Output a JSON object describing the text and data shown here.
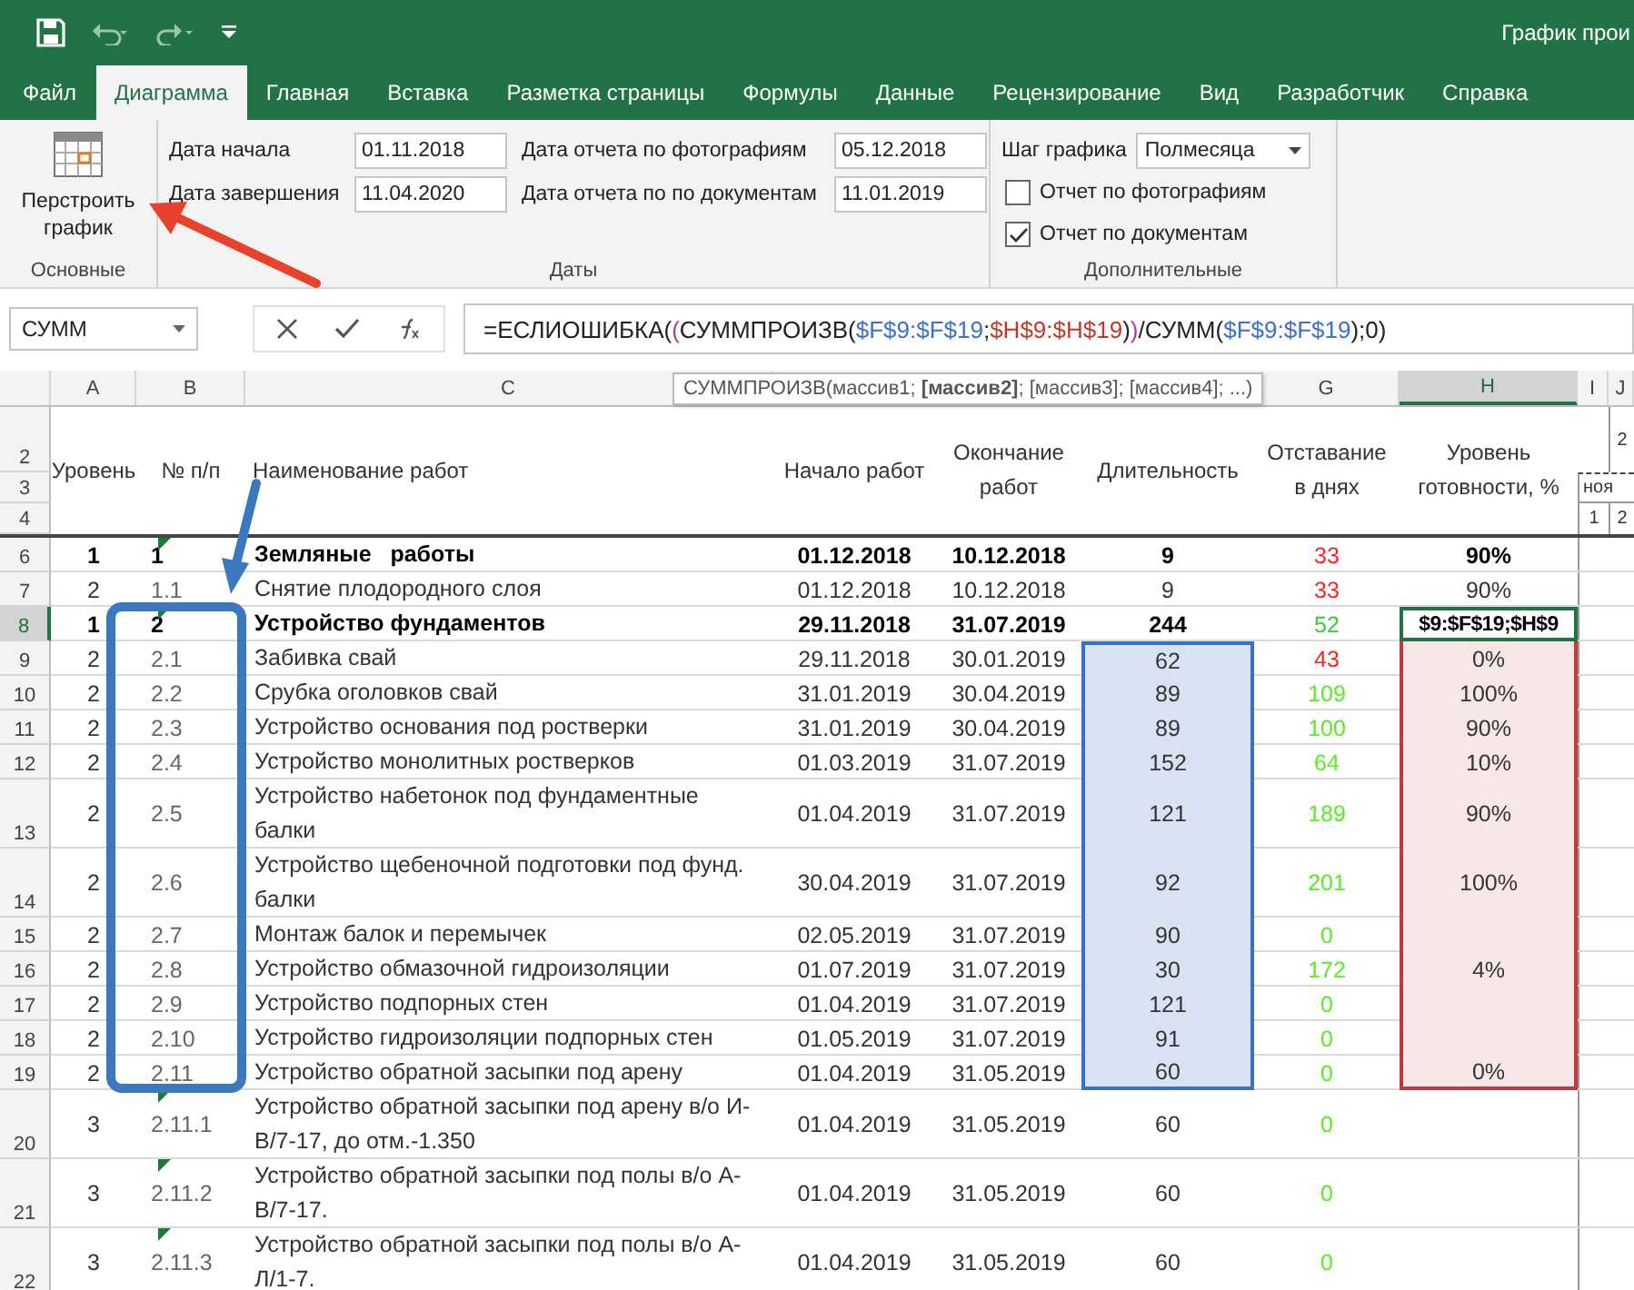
{
  "title_bar": {
    "title": "График прои"
  },
  "ribbon_tabs": [
    {
      "label": "Файл",
      "selected": false
    },
    {
      "label": "Диаграмма",
      "selected": true
    },
    {
      "label": "Главная",
      "selected": false
    },
    {
      "label": "Вставка",
      "selected": false
    },
    {
      "label": "Разметка страницы",
      "selected": false
    },
    {
      "label": "Формулы",
      "selected": false
    },
    {
      "label": "Данные",
      "selected": false
    },
    {
      "label": "Рецензирование",
      "selected": false
    },
    {
      "label": "Вид",
      "selected": false
    },
    {
      "label": "Разработчик",
      "selected": false
    },
    {
      "label": "Справка",
      "selected": false
    }
  ],
  "ribbon": {
    "main_group": {
      "label": "Основные",
      "button": "Перстроить график"
    },
    "dates_group": {
      "label": "Даты",
      "fields": [
        {
          "label": "Дата начала",
          "value": "01.11.2018"
        },
        {
          "label": "Дата отчета по фотографиям",
          "value": "05.12.2018"
        },
        {
          "label": "Дата завершения",
          "value": "11.04.2020"
        },
        {
          "label": "Дата отчета по по документам",
          "value": "11.01.2019"
        }
      ]
    },
    "extra_group": {
      "label": "Дополнительные",
      "step_label": "Шаг графика",
      "step_value": "Полмесяца",
      "checkboxes": [
        {
          "label": "Отчет по фотографиям",
          "checked": false
        },
        {
          "label": "Отчет по документам",
          "checked": true
        }
      ]
    }
  },
  "formula_bar": {
    "name_box": "СУММ",
    "segments": [
      {
        "text": "=ЕСЛИОШИБКА(",
        "color": "#222222"
      },
      {
        "text": "(",
        "color": "#b03aa0"
      },
      {
        "text": "СУММПРОИЗВ(",
        "color": "#222222"
      },
      {
        "text": "$F$9:$F$19",
        "color": "#3b6fd0"
      },
      {
        "text": ";",
        "color": "#222222"
      },
      {
        "text": "$H$9:$H$19",
        "color": "#c0392b"
      },
      {
        "text": ")",
        "color": "#222222"
      },
      {
        "text": ")",
        "color": "#b03aa0"
      },
      {
        "text": "/СУММ(",
        "color": "#222222"
      },
      {
        "text": "$F$9:$F$19",
        "color": "#3b6fd0"
      },
      {
        "text": ");0)",
        "color": "#222222"
      }
    ]
  },
  "tooltip": "СУММПРОИЗВ(массив1; **[массив2]**; [массив3]; [массив4]; ...)",
  "columns": [
    {
      "label": "A",
      "selected": false
    },
    {
      "label": "B",
      "selected": false
    },
    {
      "label": "C",
      "selected": false
    },
    {
      "label": "G",
      "selected": false
    },
    {
      "label": "H",
      "selected": true
    },
    {
      "label": "I",
      "selected": false
    },
    {
      "label": "J",
      "selected": false
    }
  ],
  "header_row_numbers": [
    "2",
    "3",
    "4"
  ],
  "headers": [
    "Уровень",
    "№ п/п",
    "Наименование работ",
    "Начало работ",
    "Окончание работ",
    "Длительность",
    "Отставание в днях",
    "Уровень готовности, %"
  ],
  "side_header": {
    "year": "2",
    "month": "ноя",
    "days": [
      "1",
      "2"
    ]
  },
  "rows": [
    {
      "num": "6",
      "level": "1",
      "code": "1",
      "name": "Земляные   работы",
      "start": "01.12.2018",
      "end": "10.12.2018",
      "duration": "9",
      "lag": "33",
      "color": "#ff2020",
      "ready": "90%",
      "bold": true,
      "tall": false,
      "active": false,
      "marker": true,
      "editing": false,
      "duration_selected": false,
      "ready_selected": false
    },
    {
      "num": "7",
      "level": "2",
      "code": "1.1",
      "name": "Снятие плодородного слоя",
      "start": "01.12.2018",
      "end": "10.12.2018",
      "duration": "9",
      "lag": "33",
      "color": "#ff2020",
      "ready": "90%",
      "bold": false,
      "tall": false,
      "active": false,
      "marker": false,
      "editing": false,
      "duration_selected": false,
      "ready_selected": false
    },
    {
      "num": "8",
      "level": "1",
      "code": "2",
      "name": "Устройство фундаментов",
      "start": "29.11.2018",
      "end": "31.07.2019",
      "duration": "244",
      "lag": "52",
      "color": "#33cc33",
      "ready": "$9:$F$19;$H$9",
      "bold": true,
      "tall": false,
      "active": true,
      "marker": true,
      "editing": true,
      "duration_selected": false,
      "ready_selected": false
    },
    {
      "num": "9",
      "level": "2",
      "code": "2.1",
      "name": "Забивка свай",
      "start": "29.11.2018",
      "end": "30.01.2019",
      "duration": "62",
      "lag": "43",
      "color": "#ff2020",
      "ready": "0%",
      "bold": false,
      "tall": false,
      "active": false,
      "marker": false,
      "editing": false,
      "duration_selected": true,
      "ready_selected": true
    },
    {
      "num": "10",
      "level": "2",
      "code": "2.2",
      "name": "Срубка оголовков свай",
      "start": "31.01.2019",
      "end": "30.04.2019",
      "duration": "89",
      "lag": "109",
      "color": "#55ee22",
      "ready": "100%",
      "bold": false,
      "tall": false,
      "active": false,
      "marker": false,
      "editing": false,
      "duration_selected": true,
      "ready_selected": true
    },
    {
      "num": "11",
      "level": "2",
      "code": "2.3",
      "name": "Устройство основания под ростверки",
      "start": "31.01.2019",
      "end": "30.04.2019",
      "duration": "89",
      "lag": "100",
      "color": "#55ee22",
      "ready": "90%",
      "bold": false,
      "tall": false,
      "active": false,
      "marker": false,
      "editing": false,
      "duration_selected": true,
      "ready_selected": true
    },
    {
      "num": "12",
      "level": "2",
      "code": "2.4",
      "name": "Устройство монолитных ростверков",
      "start": "01.03.2019",
      "end": "31.07.2019",
      "duration": "152",
      "lag": "64",
      "color": "#55ee22",
      "ready": "10%",
      "bold": false,
      "tall": false,
      "active": false,
      "marker": false,
      "editing": false,
      "duration_selected": true,
      "ready_selected": true
    },
    {
      "num": "13",
      "level": "2",
      "code": "2.5",
      "name": "Устройство набетонок под фундаментные    балки",
      "start": "01.04.2019",
      "end": "31.07.2019",
      "duration": "121",
      "lag": "189",
      "color": "#55ee22",
      "ready": "90%",
      "bold": false,
      "tall": true,
      "active": false,
      "marker": false,
      "editing": false,
      "duration_selected": true,
      "ready_selected": true
    },
    {
      "num": "14",
      "level": "2",
      "code": "2.6",
      "name": "Устройство щебеночной подготовки под фунд. балки",
      "start": "30.04.2019",
      "end": "31.07.2019",
      "duration": "92",
      "lag": "201",
      "color": "#55ee22",
      "ready": "100%",
      "bold": false,
      "tall": true,
      "active": false,
      "marker": false,
      "editing": false,
      "duration_selected": true,
      "ready_selected": true
    },
    {
      "num": "15",
      "level": "2",
      "code": "2.7",
      "name": "Монтаж балок и перемычек",
      "start": "02.05.2019",
      "end": "31.07.2019",
      "duration": "90",
      "lag": "0",
      "color": "#55ee22",
      "bold": false,
      "tall": false,
      "active": false,
      "marker": false,
      "editing": false,
      "duration_selected": true,
      "ready_selected": true
    },
    {
      "num": "16",
      "level": "2",
      "code": "2.8",
      "name": "Устройство обмазочной гидроизоляции",
      "start": "01.07.2019",
      "end": "31.07.2019",
      "duration": "30",
      "lag": "172",
      "color": "#55ee22",
      "ready": "4%",
      "bold": false,
      "tall": false,
      "active": false,
      "marker": false,
      "editing": false,
      "duration_selected": true,
      "ready_selected": true
    },
    {
      "num": "17",
      "level": "2",
      "code": "2.9",
      "name": "Устройство подпорных стен",
      "start": "01.04.2019",
      "end": "31.07.2019",
      "duration": "121",
      "lag": "0",
      "color": "#55ee22",
      "bold": false,
      "tall": false,
      "active": false,
      "marker": false,
      "editing": false,
      "duration_selected": true,
      "ready_selected": true
    },
    {
      "num": "18",
      "level": "2",
      "code": "2.10",
      "name": "Устройство гидроизоляции подпорных стен",
      "start": "01.05.2019",
      "end": "31.07.2019",
      "duration": "91",
      "lag": "0",
      "color": "#55ee22",
      "bold": false,
      "tall": false,
      "active": false,
      "marker": false,
      "editing": false,
      "duration_selected": true,
      "ready_selected": true
    },
    {
      "num": "19",
      "level": "2",
      "code": "2.11",
      "name": "Устройство обратной засыпки под арену",
      "start": "01.04.2019",
      "end": "31.05.2019",
      "duration": "60",
      "lag": "0",
      "color": "#55ee22",
      "ready": "0%",
      "bold": false,
      "tall": false,
      "active": false,
      "marker": false,
      "editing": false,
      "duration_selected": true,
      "ready_selected": true
    },
    {
      "num": "20",
      "level": "3",
      "code": "2.11.1",
      "name": "Устройство обратной засыпки под арену в/о И-В/7-17, до отм.-1.350",
      "start": "01.04.2019",
      "end": "31.05.2019",
      "duration": "60",
      "lag": "0",
      "color": "#55ee22",
      "bold": false,
      "tall": true,
      "active": false,
      "marker": true,
      "editing": false,
      "duration_selected": false,
      "ready_selected": false
    },
    {
      "num": "21",
      "level": "3",
      "code": "2.11.2",
      "name": "Устройство обратной засыпки под полы в/о А-В/7-17.",
      "start": "01.04.2019",
      "end": "31.05.2019",
      "duration": "60",
      "lag": "0",
      "color": "#55ee22",
      "bold": false,
      "tall": true,
      "active": false,
      "marker": true,
      "editing": false,
      "duration_selected": false,
      "ready_selected": false
    },
    {
      "num": "22",
      "level": "3",
      "code": "2.11.3",
      "name": "Устройство обратной засыпки под полы в/о А-Л/1-7.",
      "start": "01.04.2019",
      "end": "31.05.2019",
      "duration": "60",
      "lag": "0",
      "color": "#55ee22",
      "bold": false,
      "tall": true,
      "active": false,
      "marker": true,
      "editing": false,
      "duration_selected": false,
      "ready_selected": false
    }
  ]
}
